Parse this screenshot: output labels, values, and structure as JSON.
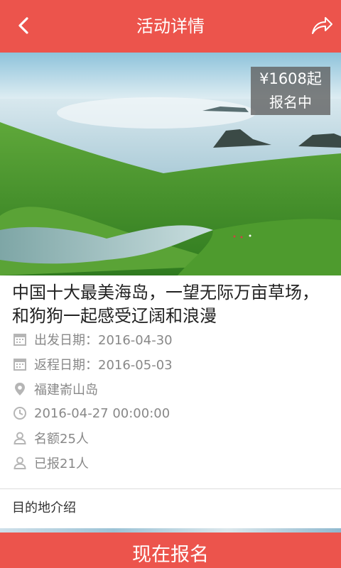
{
  "header": {
    "title": "活动详情",
    "back_icon": "chevron-left-icon",
    "share_icon": "share-icon",
    "color": "#ec544c"
  },
  "hero": {
    "price": "¥1608起",
    "status": "报名中"
  },
  "event": {
    "title": "中国十大最美海岛，一望无际万亩草场，和狗狗一起感受辽阔和浪漫",
    "info": [
      {
        "icon": "calendar-icon",
        "text": "出发日期：2016-04-30"
      },
      {
        "icon": "calendar-icon",
        "text": "返程日期：2016-05-03"
      },
      {
        "icon": "location-pin-icon",
        "text": "福建嵛山岛"
      },
      {
        "icon": "clock-icon",
        "text": "2016-04-27 00:00:00"
      },
      {
        "icon": "person-icon",
        "text": "名额25人"
      },
      {
        "icon": "person-icon",
        "text": "已报21人"
      }
    ]
  },
  "section": {
    "title": "目的地介绍"
  },
  "cta": {
    "label": "现在报名"
  }
}
